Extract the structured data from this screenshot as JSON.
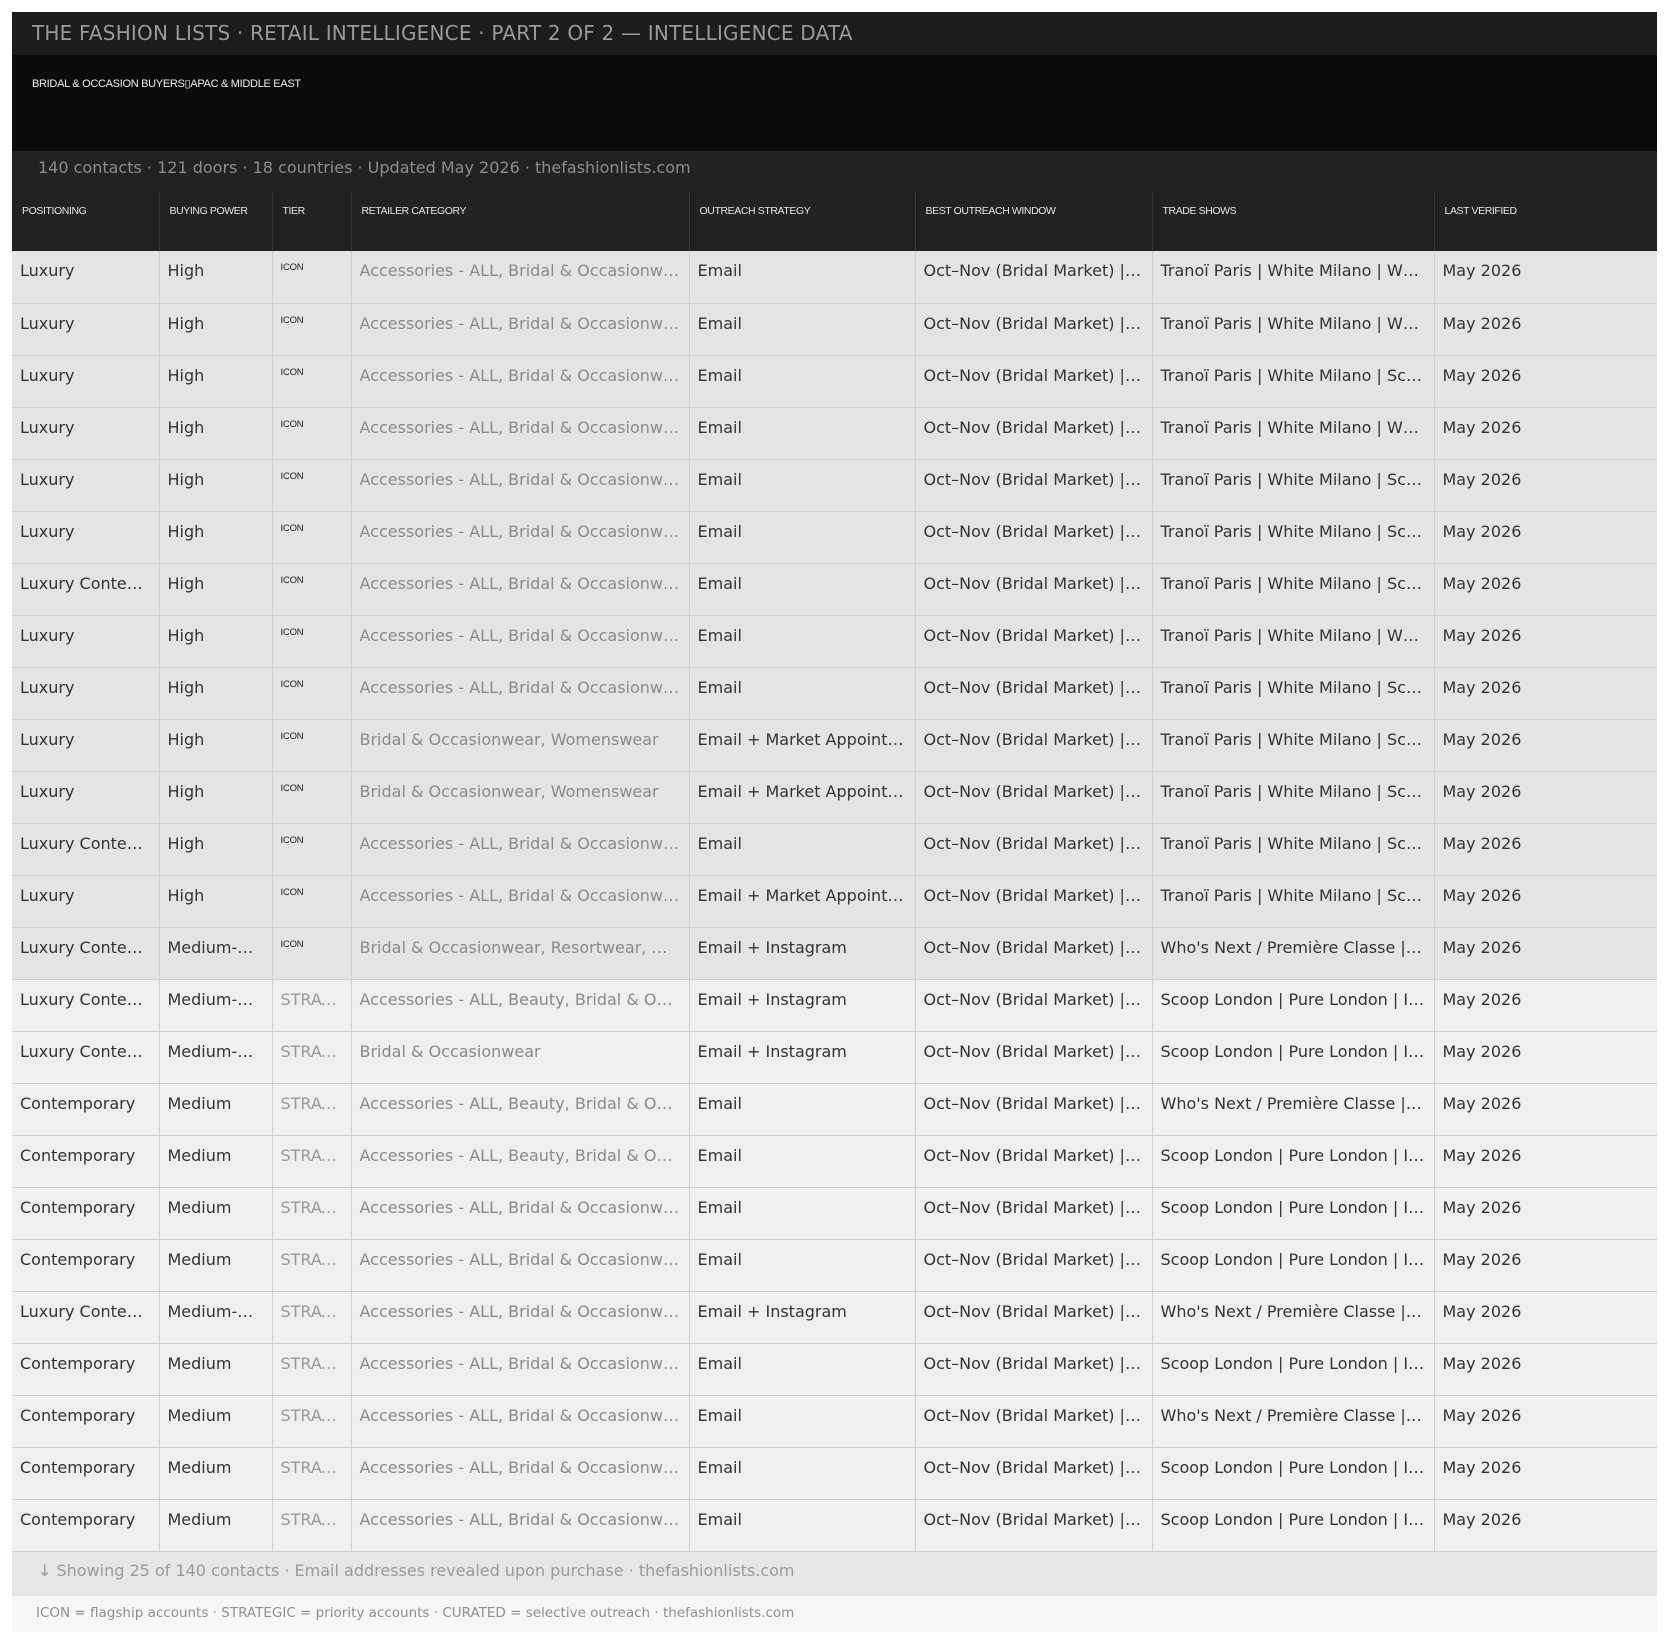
{
  "header": {
    "title": "THE FASHION LISTS  ·  RETAIL INTELLIGENCE  ·  PART 2 OF 2 — INTELLIGENCE DATA",
    "subtitle": "BRIDAL & OCCASION BUYERS▯APAC & MIDDLE EAST",
    "stats": "140 contacts  ·  121 doors  ·  18 countries  ·  Updated May 2026  ·  thefashionlists.com"
  },
  "table": {
    "columns": [
      "POSITIONING",
      "BUYING POWER",
      "TIER",
      "RETAILER CATEGORY",
      "OUTREACH STRATEGY",
      "BEST OUTREACH WINDOW",
      "TRADE SHOWS",
      "LAST VERIFIED"
    ],
    "rows": [
      [
        "Luxury",
        "High",
        "ICON",
        "Accessories - ALL, Bridal & Occasionwear, Womenswear",
        "Email",
        "Oct–Nov (Bridal Market) | Apr–May",
        "Tranoï Paris | White Milano | Who's Next",
        "May 2026"
      ],
      [
        "Luxury",
        "High",
        "ICON",
        "Accessories - ALL, Bridal & Occasionwear, Womenswear",
        "Email",
        "Oct–Nov (Bridal Market) | Apr–May",
        "Tranoï Paris | White Milano | Who's Next",
        "May 2026"
      ],
      [
        "Luxury",
        "High",
        "ICON",
        "Accessories - ALL, Bridal & Occasionwear, Womenswear",
        "Email",
        "Oct–Nov (Bridal Market) | Apr–May",
        "Tranoï Paris | White Milano | Scoop London",
        "May 2026"
      ],
      [
        "Luxury",
        "High",
        "ICON",
        "Accessories - ALL, Bridal & Occasionwear, Womenswear",
        "Email",
        "Oct–Nov (Bridal Market) | Apr–May",
        "Tranoï Paris | White Milano | Who's Next",
        "May 2026"
      ],
      [
        "Luxury",
        "High",
        "ICON",
        "Accessories - ALL, Bridal & Occasionwear, Womenswear",
        "Email",
        "Oct–Nov (Bridal Market) | Apr–May",
        "Tranoï Paris | White Milano | Scoop London",
        "May 2026"
      ],
      [
        "Luxury",
        "High",
        "ICON",
        "Accessories - ALL, Bridal & Occasionwear, Womenswear",
        "Email",
        "Oct–Nov (Bridal Market) | Apr–May",
        "Tranoï Paris | White Milano | Scoop London",
        "May 2026"
      ],
      [
        "Luxury Contemporary",
        "High",
        "ICON",
        "Accessories - ALL, Bridal & Occasionwear, Womenswear",
        "Email",
        "Oct–Nov (Bridal Market) | Apr–May",
        "Tranoï Paris | White Milano | Scoop London",
        "May 2026"
      ],
      [
        "Luxury",
        "High",
        "ICON",
        "Accessories - ALL, Bridal & Occasionwear, Womenswear",
        "Email",
        "Oct–Nov (Bridal Market) | Apr–May",
        "Tranoï Paris | White Milano | Who's Next",
        "May 2026"
      ],
      [
        "Luxury",
        "High",
        "ICON",
        "Accessories - ALL, Bridal & Occasionwear, Womenswear",
        "Email",
        "Oct–Nov (Bridal Market) | Apr–May",
        "Tranoï Paris | White Milano | Scoop London",
        "May 2026"
      ],
      [
        "Luxury",
        "High",
        "ICON",
        "Bridal & Occasionwear, Womenswear",
        "Email + Market Appointment",
        "Oct–Nov (Bridal Market) | Apr–May",
        "Tranoï Paris | White Milano | Scoop London",
        "May 2026"
      ],
      [
        "Luxury",
        "High",
        "ICON",
        "Bridal & Occasionwear, Womenswear",
        "Email + Market Appointment",
        "Oct–Nov (Bridal Market) | Apr–May",
        "Tranoï Paris | White Milano | Scoop London",
        "May 2026"
      ],
      [
        "Luxury Contemporary",
        "High",
        "ICON",
        "Accessories - ALL, Bridal & Occasionwear, Womenswear",
        "Email",
        "Oct–Nov (Bridal Market) | Apr–May",
        "Tranoï Paris | White Milano | Scoop London",
        "May 2026"
      ],
      [
        "Luxury",
        "High",
        "ICON",
        "Accessories - ALL, Bridal & Occasionwear, Womenswear",
        "Email + Market Appointment",
        "Oct–Nov (Bridal Market) | Apr–May",
        "Tranoï Paris | White Milano | Scoop London",
        "May 2026"
      ],
      [
        "Luxury Contemporary",
        "Medium-High",
        "ICON",
        "Bridal & Occasionwear, Resortwear, Womenswear",
        "Email + Instagram",
        "Oct–Nov (Bridal Market) | Apr–May",
        "Who's Next / Première Classe | CPHFW",
        "May 2026"
      ],
      [
        "Luxury Contemporary",
        "Medium-High",
        "STRATEGIC",
        "Accessories - ALL, Beauty, Bridal & Occasionwear",
        "Email + Instagram",
        "Oct–Nov (Bridal Market) | Apr–May",
        "Scoop London | Pure London | Interfiliere",
        "May 2026"
      ],
      [
        "Luxury Contemporary",
        "Medium-High",
        "STRATEGIC",
        "Bridal & Occasionwear",
        "Email + Instagram",
        "Oct–Nov (Bridal Market) | Apr–May",
        "Scoop London | Pure London | Interfiliere",
        "May 2026"
      ],
      [
        "Contemporary",
        "Medium",
        "STRATEGIC",
        "Accessories - ALL, Beauty, Bridal & Occasionwear",
        "Email",
        "Oct–Nov (Bridal Market) | Apr–May",
        "Who's Next / Première Classe | CPHFW",
        "May 2026"
      ],
      [
        "Contemporary",
        "Medium",
        "STRATEGIC",
        "Accessories - ALL, Beauty, Bridal & Occasionwear",
        "Email",
        "Oct–Nov (Bridal Market) | Apr–May",
        "Scoop London | Pure London | Interfiliere",
        "May 2026"
      ],
      [
        "Contemporary",
        "Medium",
        "STRATEGIC",
        "Accessories - ALL, Bridal & Occasionwear, Womenswear",
        "Email",
        "Oct–Nov (Bridal Market) | Apr–May",
        "Scoop London | Pure London | Interfiliere",
        "May 2026"
      ],
      [
        "Contemporary",
        "Medium",
        "STRATEGIC",
        "Accessories - ALL, Bridal & Occasionwear, Womenswear",
        "Email",
        "Oct–Nov (Bridal Market) | Apr–May",
        "Scoop London | Pure London | Interfiliere",
        "May 2026"
      ],
      [
        "Luxury Contemporary",
        "Medium-High",
        "STRATEGIC",
        "Accessories - ALL, Bridal & Occasionwear, Womenswear",
        "Email + Instagram",
        "Oct–Nov (Bridal Market) | Apr–May",
        "Who's Next / Première Classe | CPHFW",
        "May 2026"
      ],
      [
        "Contemporary",
        "Medium",
        "STRATEGIC",
        "Accessories - ALL, Bridal & Occasionwear, Womenswear",
        "Email",
        "Oct–Nov (Bridal Market) | Apr–May",
        "Scoop London | Pure London | Interfiliere",
        "May 2026"
      ],
      [
        "Contemporary",
        "Medium",
        "STRATEGIC",
        "Accessories - ALL, Bridal & Occasionwear, Womenswear",
        "Email",
        "Oct–Nov (Bridal Market) | Apr–May",
        "Who's Next / Première Classe | CPHFW",
        "May 2026"
      ],
      [
        "Contemporary",
        "Medium",
        "STRATEGIC",
        "Accessories - ALL, Bridal & Occasionwear, Womenswear",
        "Email",
        "Oct–Nov (Bridal Market) | Apr–May",
        "Scoop London | Pure London | Interfiliere",
        "May 2026"
      ],
      [
        "Contemporary",
        "Medium",
        "STRATEGIC",
        "Accessories - ALL, Bridal & Occasionwear, Womenswear",
        "Email",
        "Oct–Nov (Bridal Market) | Apr–May",
        "Scoop London | Pure London | Interfiliere",
        "May 2026"
      ]
    ]
  },
  "footer": {
    "showing": "↓  Showing 25 of 140 contacts  ·  Email addresses revealed upon purchase  ·  thefashionlists.com",
    "legend": "ICON = flagship accounts  ·  STRATEGIC = priority accounts  ·  CURATED = selective outreach  ·  thefashionlists.com"
  },
  "colors": {
    "topbar_bg": "#1c1c1c",
    "banner_bg": "#0b0b0b",
    "header_bg": "#222222",
    "icon_row_bg": "#e4e4e4",
    "strategic_row_bg": "#efefef"
  }
}
